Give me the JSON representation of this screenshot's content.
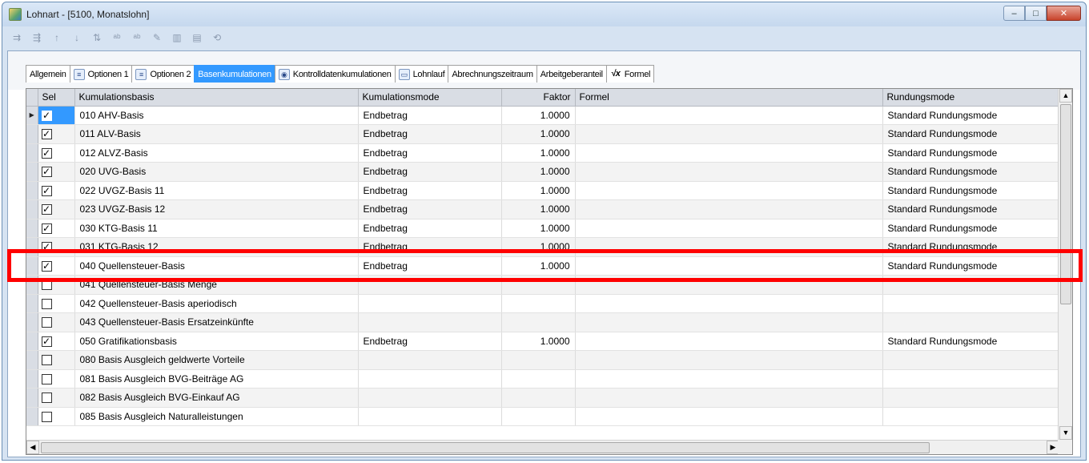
{
  "window": {
    "title": "Lohnart - [5100, Monatslohn]",
    "controls": {
      "minimize": "–",
      "maximize": "□",
      "close": "✕"
    }
  },
  "toolbar": {
    "icons": [
      "insert-row-icon",
      "delete-row-icon",
      "move-up-icon",
      "move-down-icon",
      "sort-az-icon",
      "spellcheck-icon",
      "text-format-icon",
      "edit-icon",
      "column-chooser-icon",
      "column-filter-icon",
      "history-icon"
    ]
  },
  "tabs": [
    {
      "label": "Allgemein",
      "icon": "",
      "active": false
    },
    {
      "label": "Optionen 1",
      "icon": "options-icon",
      "active": false
    },
    {
      "label": "Optionen 2",
      "icon": "options-icon",
      "active": false
    },
    {
      "label": "Basenkumulationen",
      "icon": "",
      "active": true
    },
    {
      "label": "Kontrolldatenkumulationen",
      "icon": "control-icon",
      "active": false
    },
    {
      "label": "Lohnlauf",
      "icon": "pages-icon",
      "active": false
    },
    {
      "label": "Abrechnungszeitraum",
      "icon": "",
      "active": false
    },
    {
      "label": "Arbeitgeberanteil",
      "icon": "",
      "active": false
    },
    {
      "label": "Formel",
      "icon": "formula-icon",
      "active": false
    }
  ],
  "grid": {
    "columns": {
      "sel": "Sel",
      "basis": "Kumulationsbasis",
      "mode": "Kumulationsmode",
      "faktor": "Faktor",
      "formel": "Formel",
      "rundung": "Rundungsmode"
    },
    "rows": [
      {
        "checked": true,
        "basis": "010 AHV-Basis",
        "mode": "Endbetrag",
        "faktor": "1.0000",
        "formel": "",
        "rundung": "Standard Rundungsmode"
      },
      {
        "checked": true,
        "basis": "011 ALV-Basis",
        "mode": "Endbetrag",
        "faktor": "1.0000",
        "formel": "",
        "rundung": "Standard Rundungsmode"
      },
      {
        "checked": true,
        "basis": "012 ALVZ-Basis",
        "mode": "Endbetrag",
        "faktor": "1.0000",
        "formel": "",
        "rundung": "Standard Rundungsmode"
      },
      {
        "checked": true,
        "basis": "020 UVG-Basis",
        "mode": "Endbetrag",
        "faktor": "1.0000",
        "formel": "",
        "rundung": "Standard Rundungsmode"
      },
      {
        "checked": true,
        "basis": "022 UVGZ-Basis 11",
        "mode": "Endbetrag",
        "faktor": "1.0000",
        "formel": "",
        "rundung": "Standard Rundungsmode"
      },
      {
        "checked": true,
        "basis": "023 UVGZ-Basis 12",
        "mode": "Endbetrag",
        "faktor": "1.0000",
        "formel": "",
        "rundung": "Standard Rundungsmode"
      },
      {
        "checked": true,
        "basis": "030 KTG-Basis 11",
        "mode": "Endbetrag",
        "faktor": "1.0000",
        "formel": "",
        "rundung": "Standard Rundungsmode"
      },
      {
        "checked": true,
        "basis": "031 KTG-Basis 12",
        "mode": "Endbetrag",
        "faktor": "1.0000",
        "formel": "",
        "rundung": "Standard Rundungsmode"
      },
      {
        "checked": true,
        "basis": "040 Quellensteuer-Basis",
        "mode": "Endbetrag",
        "faktor": "1.0000",
        "formel": "",
        "rundung": "Standard Rundungsmode"
      },
      {
        "checked": false,
        "basis": "041 Quellensteuer-Basis Menge",
        "mode": "",
        "faktor": "",
        "formel": "",
        "rundung": ""
      },
      {
        "checked": false,
        "basis": "042 Quellensteuer-Basis aperiodisch",
        "mode": "",
        "faktor": "",
        "formel": "",
        "rundung": ""
      },
      {
        "checked": false,
        "basis": "043 Quellensteuer-Basis Ersatzeinkünfte",
        "mode": "",
        "faktor": "",
        "formel": "",
        "rundung": ""
      },
      {
        "checked": true,
        "basis": "050 Gratifikationsbasis",
        "mode": "Endbetrag",
        "faktor": "1.0000",
        "formel": "",
        "rundung": "Standard Rundungsmode"
      },
      {
        "checked": false,
        "basis": "080 Basis Ausgleich geldwerte Vorteile",
        "mode": "",
        "faktor": "",
        "formel": "",
        "rundung": ""
      },
      {
        "checked": false,
        "basis": "081 Basis Ausgleich BVG-Beiträge AG",
        "mode": "",
        "faktor": "",
        "formel": "",
        "rundung": ""
      },
      {
        "checked": false,
        "basis": "082 Basis Ausgleich BVG-Einkauf AG",
        "mode": "",
        "faktor": "",
        "formel": "",
        "rundung": ""
      },
      {
        "checked": false,
        "basis": "085 Basis Ausgleich Naturalleistungen",
        "mode": "",
        "faktor": "",
        "formel": "",
        "rundung": ""
      }
    ],
    "current_row": 0,
    "highlighted_row": 8
  },
  "scrollbars": {
    "up": "▲",
    "down": "▼",
    "left": "◀",
    "right": "▶"
  },
  "colors": {
    "highlight_box": "#ff0000",
    "active_tab": "#3399ff",
    "selection": "#3399ff"
  }
}
